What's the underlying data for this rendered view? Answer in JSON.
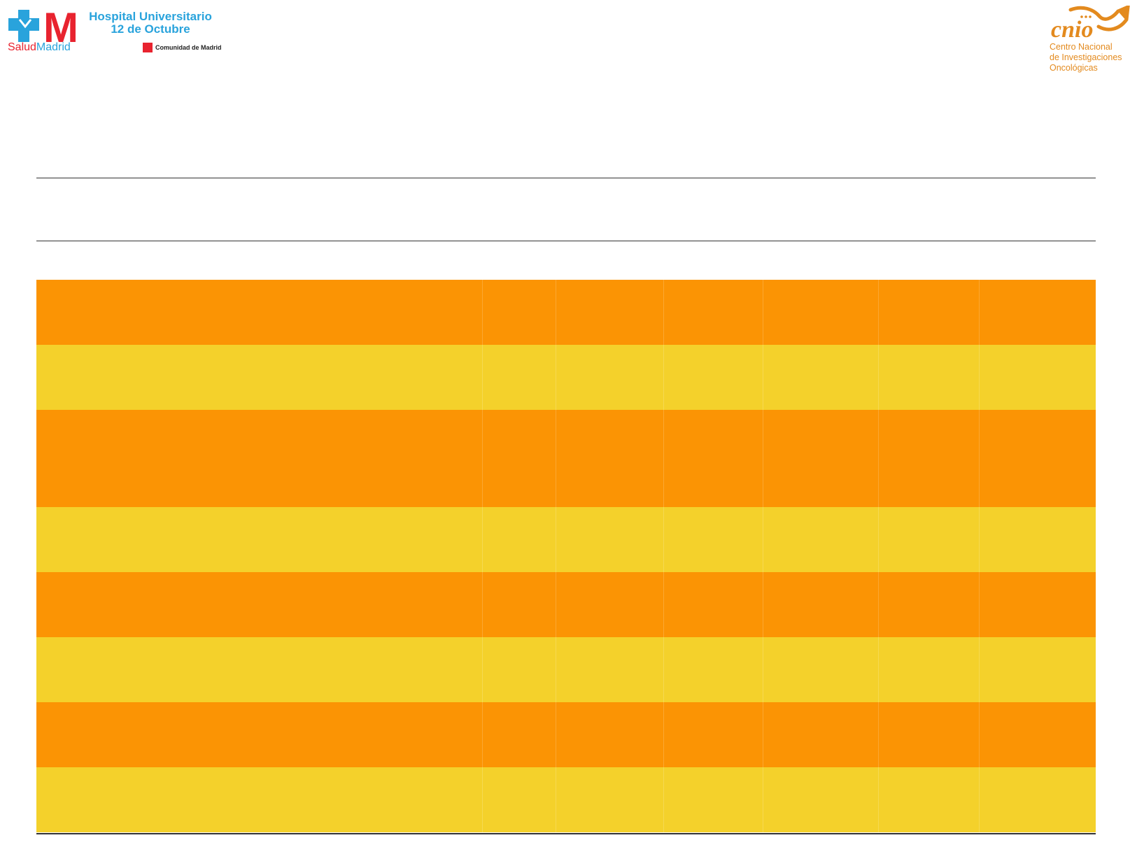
{
  "header": {
    "left_logo": {
      "brand_word_part1": "Salud",
      "brand_word_part2": "Madrid",
      "hospital_line1": "Hospital Universitario",
      "hospital_line2": "12 de Octubre",
      "community_label": "Comunidad de Madrid",
      "brand_red": "#e8232f",
      "brand_blue": "#29a3dc"
    },
    "right_logo": {
      "acronym": "cnio",
      "line1": "Centro Nacional",
      "line2": "de Investigaciones",
      "line3": "Oncológicas",
      "brand_orange": "#e38a1e"
    }
  },
  "colors": {
    "row_orange": "#fb9404",
    "row_yellow": "#f4d12b"
  },
  "table": {
    "rows": [
      {
        "color": "orange",
        "cells": [
          "",
          "",
          "",
          "",
          "",
          "",
          ""
        ]
      },
      {
        "color": "yellow",
        "cells": [
          "",
          "",
          "",
          "",
          "",
          "",
          ""
        ]
      },
      {
        "color": "orange",
        "cells": [
          "",
          "",
          "",
          "",
          "",
          "",
          ""
        ]
      },
      {
        "color": "yellow",
        "cells": [
          "",
          "",
          "",
          "",
          "",
          "",
          ""
        ]
      },
      {
        "color": "orange",
        "cells": [
          "",
          "",
          "",
          "",
          "",
          "",
          ""
        ]
      },
      {
        "color": "yellow",
        "cells": [
          "",
          "",
          "",
          "",
          "",
          "",
          ""
        ]
      },
      {
        "color": "orange",
        "cells": [
          "",
          "",
          "",
          "",
          "",
          "",
          ""
        ]
      },
      {
        "color": "yellow",
        "cells": [
          "",
          "",
          "",
          "",
          "",
          "",
          ""
        ]
      }
    ]
  }
}
